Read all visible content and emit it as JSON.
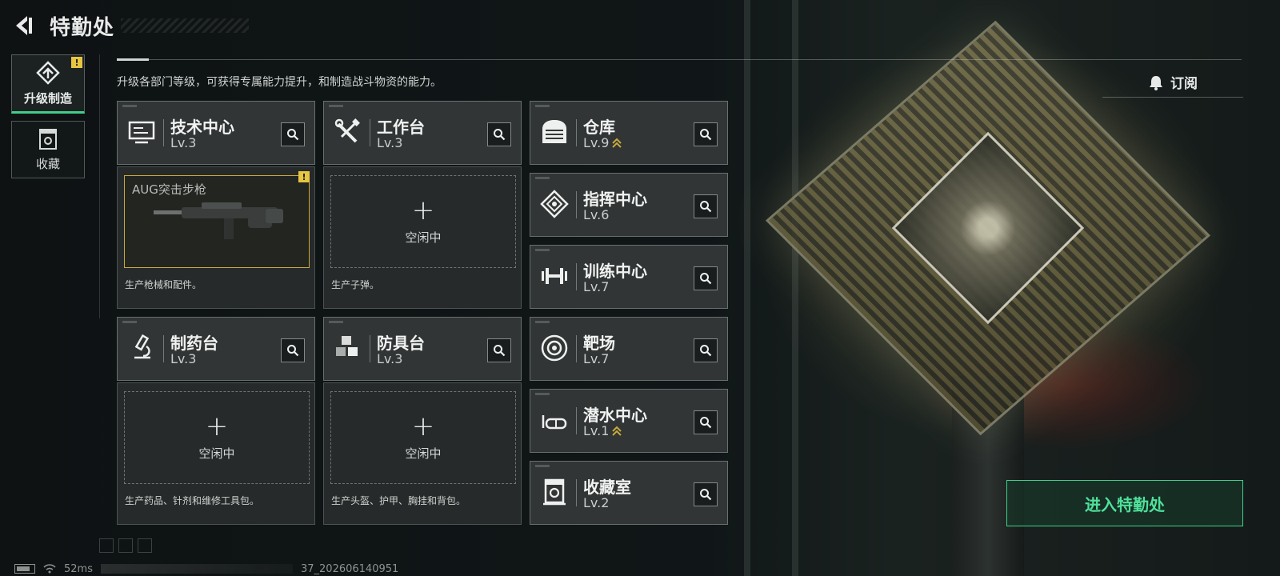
{
  "header": {
    "title": "特勤处"
  },
  "subtitle": "升级各部门等级，可获得专属能力提升，和制造战斗物资的能力。",
  "sidebar": {
    "tabs": [
      {
        "label": "升级制造",
        "active": true,
        "warning": "!"
      },
      {
        "label": "收藏",
        "active": false
      }
    ]
  },
  "subscribe": {
    "label": "订阅"
  },
  "departments": [
    {
      "name": "技术中心",
      "level": "Lv.3",
      "icon": "monitor-icon"
    },
    {
      "name": "工作台",
      "level": "Lv.3",
      "icon": "tools-icon"
    },
    {
      "name": "仓库",
      "level": "Lv.9",
      "icon": "warehouse-icon",
      "upgradable": true
    },
    {
      "name": "指挥中心",
      "level": "Lv.6",
      "icon": "command-icon"
    },
    {
      "name": "训练中心",
      "level": "Lv.7",
      "icon": "dumbbell-icon"
    },
    {
      "name": "制药台",
      "level": "Lv.3",
      "icon": "microscope-icon"
    },
    {
      "name": "防具台",
      "level": "Lv.3",
      "icon": "cubes-icon"
    },
    {
      "name": "靶场",
      "level": "Lv.7",
      "icon": "target-icon"
    },
    {
      "name": "潜水中心",
      "level": "Lv.1",
      "icon": "goggles-icon",
      "upgradable": true
    },
    {
      "name": "收藏室",
      "level": "Lv.2",
      "icon": "collection-icon"
    }
  ],
  "production": {
    "tech": {
      "item": "AUG突击步枪",
      "desc": "生产枪械和配件。",
      "warning": "!"
    },
    "workbench": {
      "status": "空闲中",
      "desc": "生产子弹。"
    },
    "pharmacy": {
      "status": "空闲中",
      "desc": "生产药品、针剂和维修工具包。"
    },
    "armor": {
      "status": "空闲中",
      "desc": "生产头盔、护甲、胸挂和背包。"
    }
  },
  "enter_button": {
    "label": "进入特勤处"
  },
  "status": {
    "ping": "52ms",
    "build": "37_202606140951"
  },
  "colors": {
    "accent": "#3fd08a",
    "warning": "#e7c542",
    "upgrade": "#c9a93a"
  }
}
